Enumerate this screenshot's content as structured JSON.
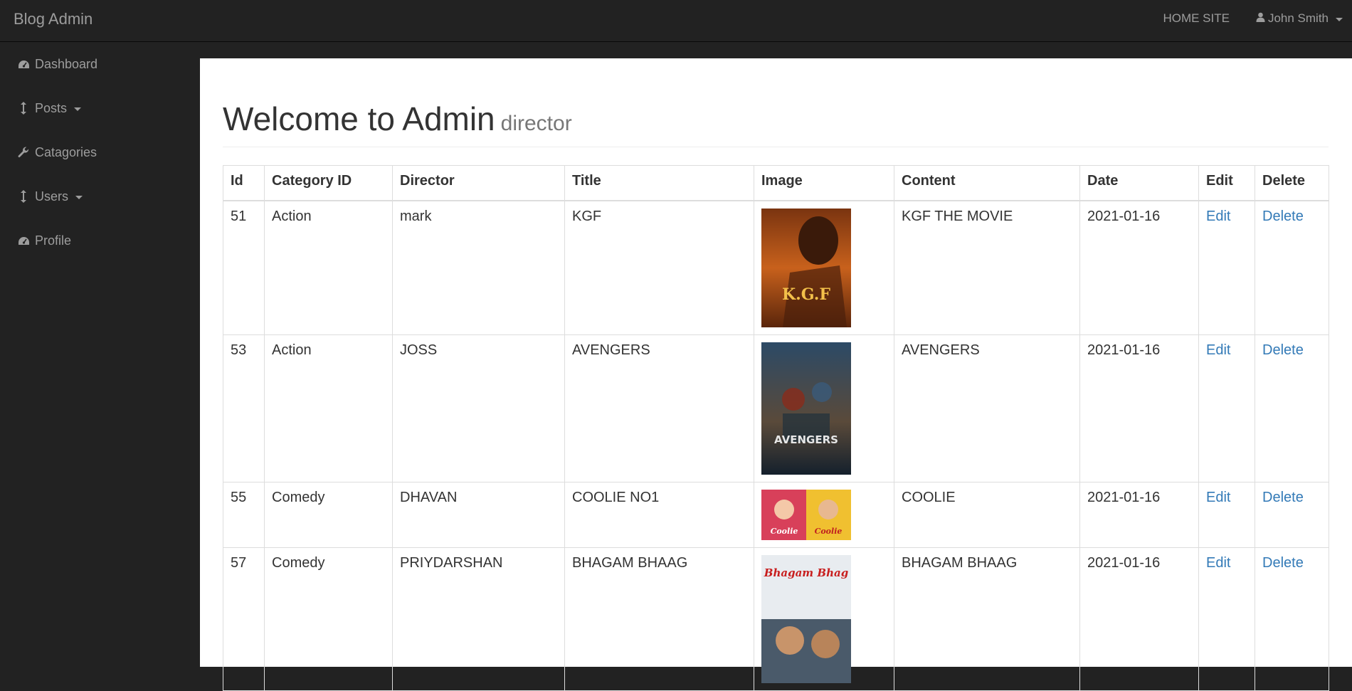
{
  "brand": "Blog Admin",
  "nav": {
    "home_site": "HOME SITE",
    "user_name": "John Smith"
  },
  "sidebar": {
    "items": [
      {
        "label": "Dashboard",
        "icon": "dashboard-icon"
      },
      {
        "label": "Posts",
        "icon": "arrows-v-icon"
      },
      {
        "label": "Catagories",
        "icon": "wrench-icon"
      },
      {
        "label": "Users",
        "icon": "arrows-v-icon"
      },
      {
        "label": "Profile",
        "icon": "dashboard-icon"
      }
    ]
  },
  "page": {
    "title": "Welcome to Admin",
    "subtitle": "director"
  },
  "table": {
    "headers": [
      "Id",
      "Category ID",
      "Director",
      "Title",
      "Image",
      "Content",
      "Date",
      "Edit",
      "Delete"
    ],
    "rows": [
      {
        "id": "51",
        "category": "Action",
        "director": "mark",
        "title": "KGF",
        "content": "KGF THE MOVIE",
        "date": "2021-01-16",
        "edit": "Edit",
        "delete": "Delete",
        "poster_text": "K.G.F"
      },
      {
        "id": "53",
        "category": "Action",
        "director": "JOSS",
        "title": "AVENGERS",
        "content": "AVENGERS",
        "date": "2021-01-16",
        "edit": "Edit",
        "delete": "Delete",
        "poster_text": "AVENGERS"
      },
      {
        "id": "55",
        "category": "Comedy",
        "director": "DHAVAN",
        "title": "COOLIE NO1",
        "content": "COOLIE",
        "date": "2021-01-16",
        "edit": "Edit",
        "delete": "Delete",
        "poster_text": "Coolie"
      },
      {
        "id": "57",
        "category": "Comedy",
        "director": "PRIYDARSHAN",
        "title": "BHAGAM BHAAG",
        "content": "BHAGAM BHAAG",
        "date": "2021-01-16",
        "edit": "Edit",
        "delete": "Delete",
        "poster_text": "Bhagam Bhag"
      }
    ]
  },
  "colors": {
    "navbar_bg": "#222222",
    "nav_text": "#9d9d9d",
    "link": "#337ab7"
  }
}
